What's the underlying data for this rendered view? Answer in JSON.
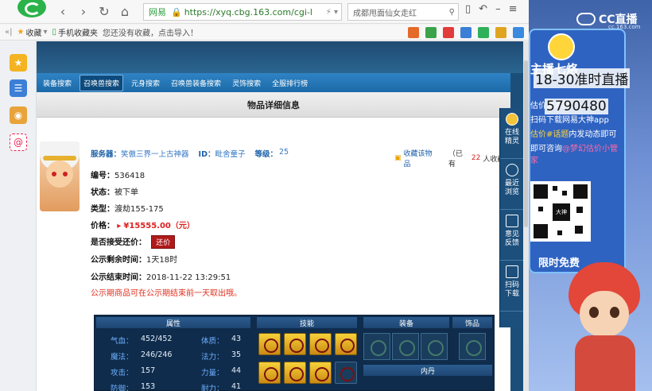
{
  "browser": {
    "nav": {
      "back": "‹",
      "forward": "›",
      "refresh": "↻",
      "home": "⌂"
    },
    "url": {
      "site": "网易",
      "text": "https://xyq.cbg.163.com/cgi-l"
    },
    "search": {
      "text": "成都甩面仙女走红",
      "icon": "⚲"
    },
    "bookmarks": {
      "collapse": "«|",
      "favorites": "收藏",
      "mobile": "手机收藏夹",
      "tip": "您还没有收藏，点击导入！"
    }
  },
  "page": {
    "tabs": [
      "装备搜索",
      "召唤兽搜索",
      "元身搜索",
      "召唤兽装备搜索",
      "灵饰搜索",
      "全服排行榜"
    ],
    "active_tab": 1,
    "panel_title": "物品详细信息",
    "item": {
      "server_label": "服务器：",
      "server_value": "笑傲三界一上古神器",
      "id_label": "ID：",
      "id_value": "毗舍童子",
      "level_label": "等级：",
      "level_value": "25",
      "favorite_label": "收藏该物品",
      "favorite_count_prefix": "（已有",
      "favorite_count": "22",
      "favorite_count_suffix": "人收藏）",
      "rows": {
        "number_label": "编号：",
        "number_value": "536418",
        "status_label": "状态：",
        "status_value": "被下单",
        "type_label": "类型：",
        "type_value": "渡劫155-175",
        "price_label": "价格：",
        "price_value": "¥15555.00（元）",
        "bargain_label": "是否接受还价：",
        "bargain_button": "还价",
        "remain_label": "公示剩余时间：",
        "remain_value": "1天18时",
        "end_label": "公示结束时间：",
        "end_value": "2018-11-22 13:29:51"
      },
      "warning": "公示期商品可在公示期结束前一天取出哦。"
    },
    "stats_section": {
      "headers": {
        "attributes": "属性",
        "skills": "技能",
        "equipment": "装备",
        "accessory": "饰品",
        "inner": "内丹"
      },
      "left": [
        {
          "label": "气血：",
          "value": "452/452"
        },
        {
          "label": "魔法：",
          "value": "246/246"
        },
        {
          "label": "攻击：",
          "value": "157"
        },
        {
          "label": "防御：",
          "value": "153"
        }
      ],
      "right": [
        {
          "label": "体质：",
          "value": "43"
        },
        {
          "label": "法力：",
          "value": "35"
        },
        {
          "label": "力量：",
          "value": "44"
        },
        {
          "label": "耐力：",
          "value": "41"
        }
      ]
    },
    "sidebox": [
      {
        "label": "在线\n精灵"
      },
      {
        "label": "最近\n浏览"
      },
      {
        "label": "意见\n反馈"
      },
      {
        "label": "扫码\n下载"
      }
    ]
  },
  "stream": {
    "logo": "CC直播",
    "logo_sub": "cc.163.com",
    "anchor_name": "主播七烙",
    "overlay_right_top": "18-30准时直播",
    "overlay_mid": "估价请添加",
    "overlay_num": "5790480",
    "line1": "扫码下载网易大神app",
    "line2_yellow": "估价#话题",
    "line2_rest": "内发动态即可",
    "line3": "即可咨询",
    "line3_pink": "@梦幻估价小管家",
    "qr_center": "大神",
    "free": "限时免费"
  }
}
